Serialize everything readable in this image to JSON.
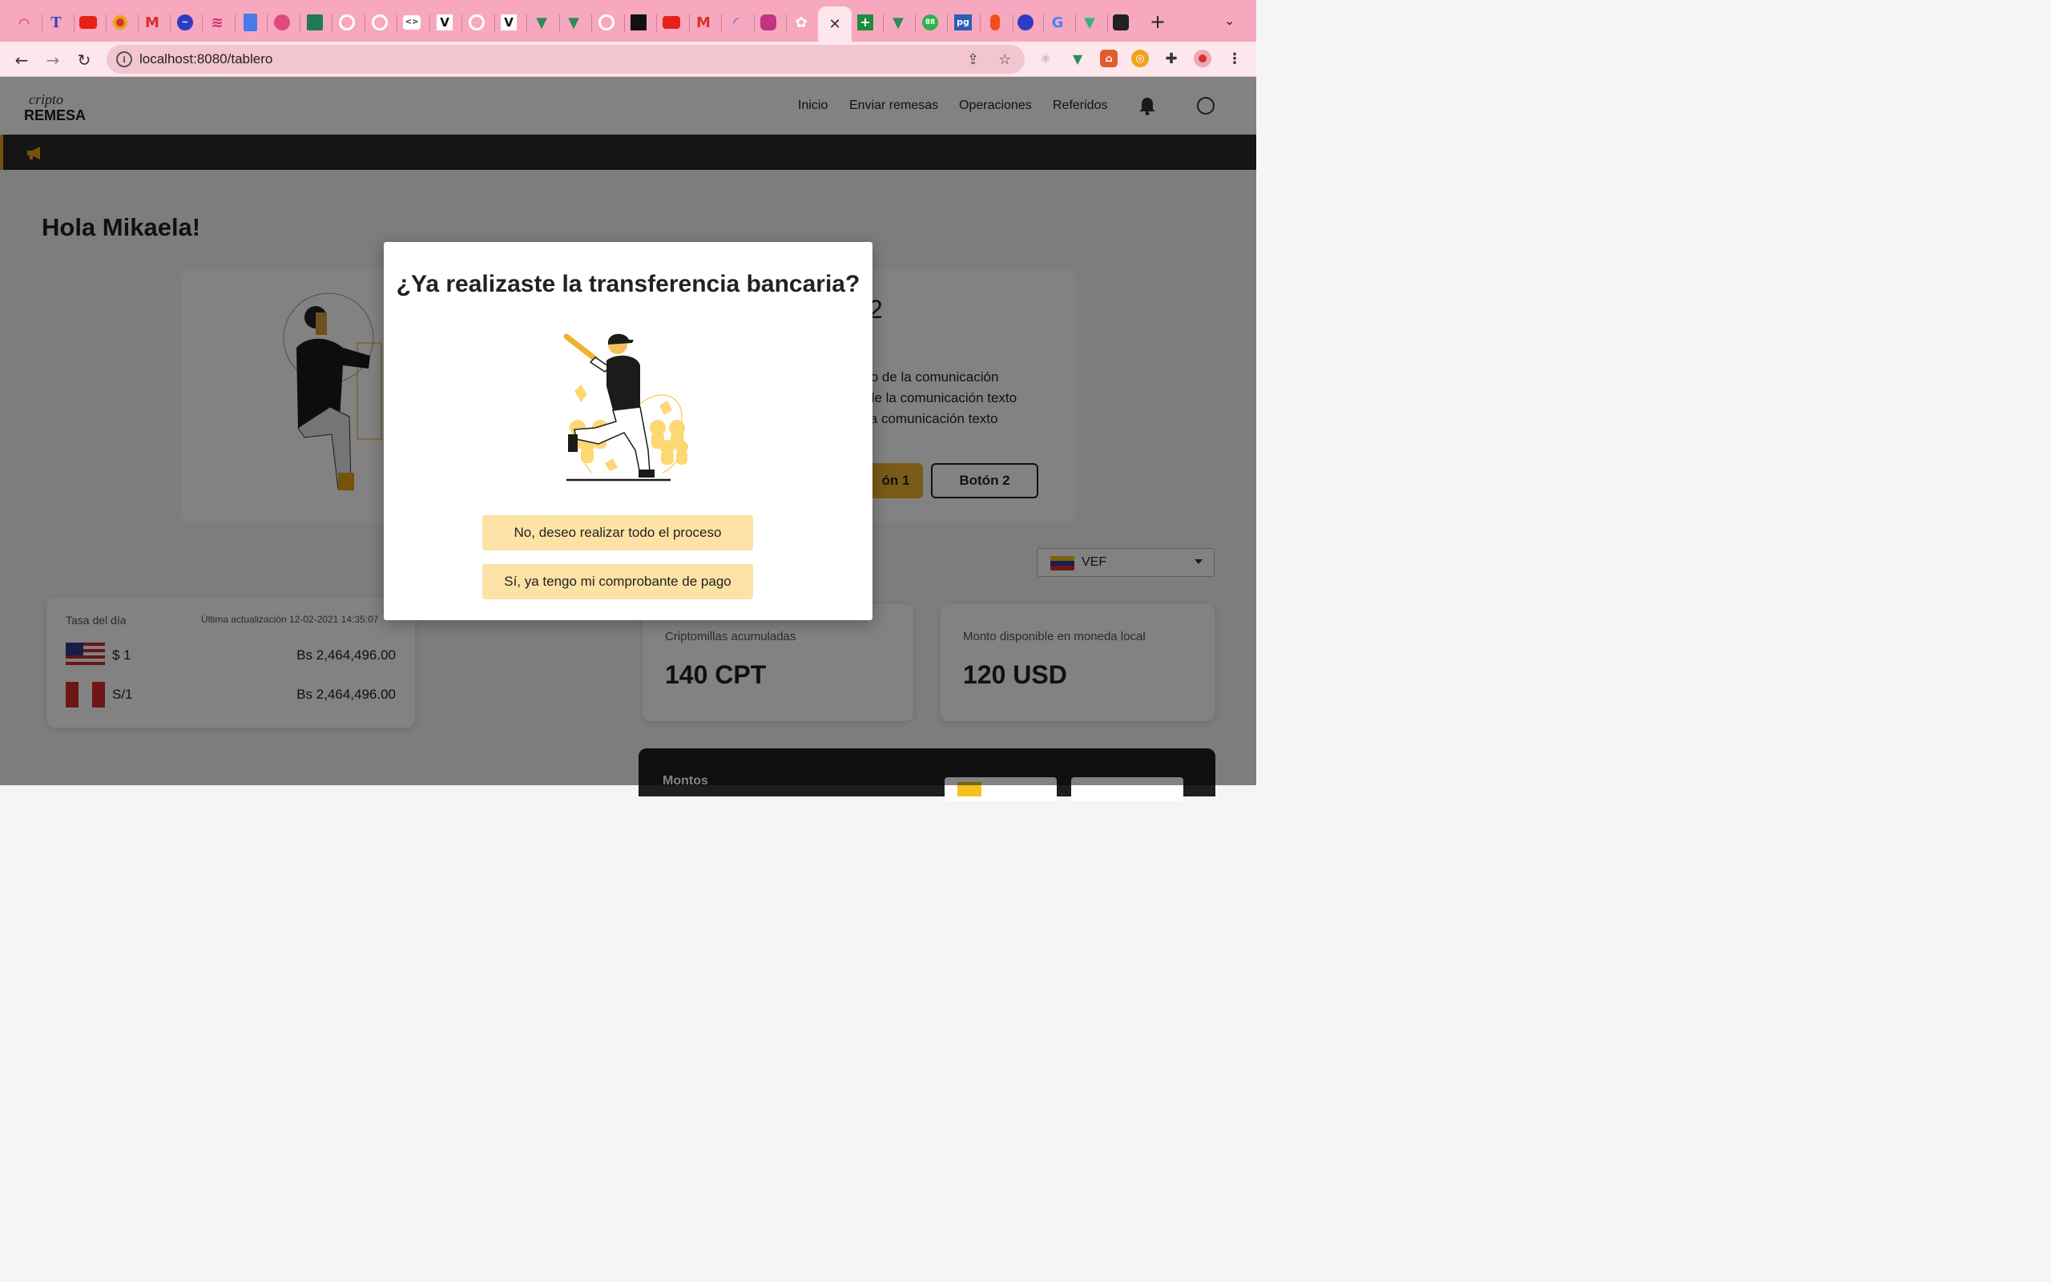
{
  "browser": {
    "url": "localhost:8080/tablero",
    "active_tab_close": "✕",
    "new_tab": "+",
    "tab_menu": "⌄"
  },
  "app": {
    "logo_top": "cripto",
    "logo_bottom": "REMESA",
    "nav": [
      "Inicio",
      "Enviar remesas",
      "Operaciones",
      "Referidos"
    ],
    "greeting": "Hola Mikaela!",
    "hero": {
      "number_fragment": "2",
      "text_fragment": "to de la comunicación\nde la comunicación texto\nla comunicación texto",
      "button1_fragment": "ón 1",
      "button2": "Botón 2"
    },
    "currency_select": "VEF",
    "rate_card": {
      "title": "Tasa del día",
      "updated": "Última actualización 12-02-2021 14:35:07",
      "rows": [
        {
          "currency": "$ 1",
          "value": "Bs 2,464,496.00"
        },
        {
          "currency": "S/1",
          "value": "Bs 2,464,496.00"
        }
      ]
    },
    "stats": [
      {
        "label": "Criptomillas acumuladas",
        "value": "140 CPT"
      },
      {
        "label": "Monto disponible en moneda local",
        "value": "120 USD"
      }
    ],
    "montos_title": "Montos"
  },
  "modal": {
    "title": "¿Ya realizaste la transferencia bancaria?",
    "button_no": "No, deseo realizar todo el proceso",
    "button_yes": "Sí, ya tengo mi comprobante de pago"
  },
  "colors": {
    "tabstrip": "#f7a8be",
    "toolbar": "#fde6ec",
    "accent": "#f0b12d",
    "modal_button": "#fde2a6"
  }
}
